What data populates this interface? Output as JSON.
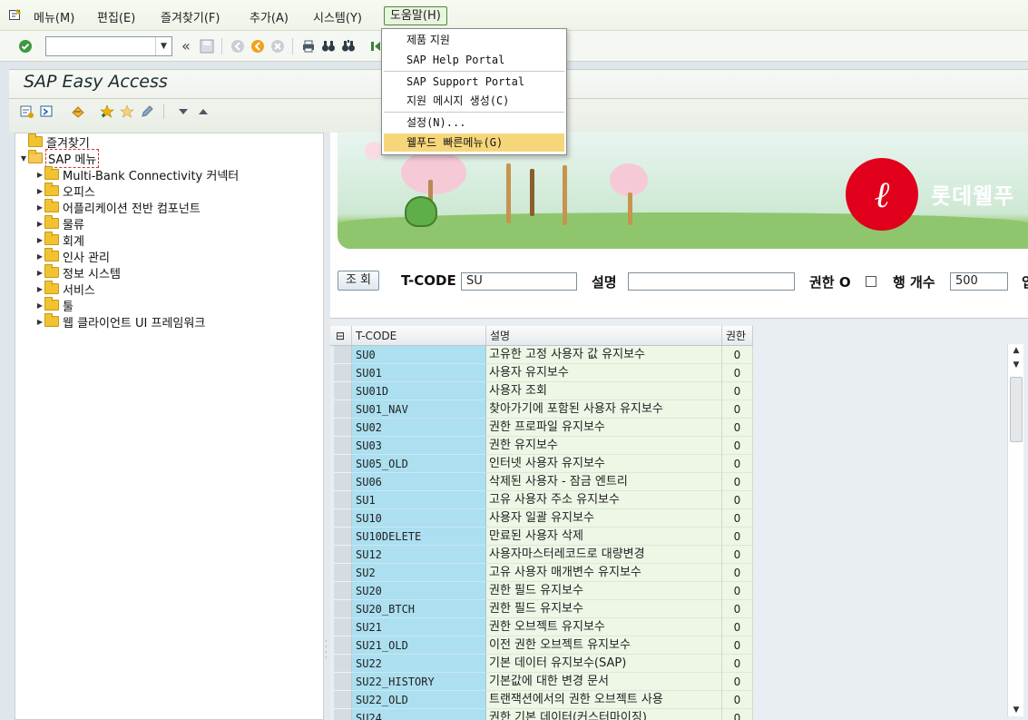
{
  "menubar": {
    "items": [
      "메뉴(M)",
      "편집(E)",
      "즐겨찾기(F)",
      "추가(A)",
      "시스템(Y)",
      "도움말(H)"
    ]
  },
  "help_menu": {
    "items": [
      "제품 지원",
      "SAP Help Portal",
      "SAP Support Portal",
      "지원 메시지 생성(C)",
      "설정(N)...",
      "웰푸드 빠른메뉴(G)"
    ],
    "highlighted_index": 5
  },
  "toolbar": {
    "command_value": "",
    "collapse_glyph": "«"
  },
  "page": {
    "title": "SAP Easy Access"
  },
  "tree": {
    "favorites": "즐겨찾기",
    "sap_menu": "SAP 메뉴",
    "children": [
      "Multi-Bank Connectivity 커넥터",
      "오피스",
      "어플리케이션 전반 컴포넌트",
      "물류",
      "회계",
      "인사 관리",
      "정보 시스템",
      "서비스",
      "툴",
      "웹 클라이언트 UI 프레임워크"
    ]
  },
  "banner": {
    "brand_text": "롯데웰푸"
  },
  "query": {
    "search_button": "조 회",
    "tcode_label": "T-CODE",
    "tcode_value": "SU",
    "desc_label": "설명",
    "desc_value": "",
    "auth_label": "권한 O",
    "rows_label": "행 개수",
    "rows_value": "500",
    "trailing_label": "입"
  },
  "grid": {
    "headers": [
      "T-CODE",
      "설명",
      "권한"
    ],
    "rows": [
      {
        "code": "SU0",
        "desc": "고유한 고정 사용자 값 유지보수",
        "auth": "0"
      },
      {
        "code": "SU01",
        "desc": "사용자 유지보수",
        "auth": "0"
      },
      {
        "code": "SU01D",
        "desc": "사용자 조회",
        "auth": "0"
      },
      {
        "code": "SU01_NAV",
        "desc": "찾아가기에 포함된 사용자 유지보수",
        "auth": "0"
      },
      {
        "code": "SU02",
        "desc": "권한 프로파일 유지보수",
        "auth": "0"
      },
      {
        "code": "SU03",
        "desc": "권한 유지보수",
        "auth": "0"
      },
      {
        "code": "SU05_OLD",
        "desc": "인터넷 사용자 유지보수",
        "auth": "0"
      },
      {
        "code": "SU06",
        "desc": "삭제된 사용자 - 잠금 엔트리",
        "auth": "0"
      },
      {
        "code": "SU1",
        "desc": "고유 사용자 주소 유지보수",
        "auth": "0"
      },
      {
        "code": "SU10",
        "desc": "사용자 일괄 유지보수",
        "auth": "0"
      },
      {
        "code": "SU10DELETE",
        "desc": "만료된 사용자 삭제",
        "auth": "0"
      },
      {
        "code": "SU12",
        "desc": "사용자마스터레코드로 대량변경",
        "auth": "0"
      },
      {
        "code": "SU2",
        "desc": "고유 사용자 매개변수 유지보수",
        "auth": "0"
      },
      {
        "code": "SU20",
        "desc": "권한 필드 유지보수",
        "auth": "0"
      },
      {
        "code": "SU20_BTCH",
        "desc": "권한 필드 유지보수",
        "auth": "0"
      },
      {
        "code": "SU21",
        "desc": "권한 오브젝트 유지보수",
        "auth": "0"
      },
      {
        "code": "SU21_OLD",
        "desc": "이전 권한 오브젝트 유지보수",
        "auth": "0"
      },
      {
        "code": "SU22",
        "desc": "기본 데이터 유지보수(SAP)",
        "auth": "0"
      },
      {
        "code": "SU22_HISTORY",
        "desc": "기본값에 대한 변경 문서",
        "auth": "0"
      },
      {
        "code": "SU22_OLD",
        "desc": "트랜잭션에서의 권한 오브젝트 사용",
        "auth": "0"
      },
      {
        "code": "SU24",
        "desc": "권한 기본 데이터(커스터마이징)",
        "auth": "0"
      }
    ]
  },
  "colors": {
    "tcode_cell": "#acdfef",
    "desc_cell": "#eef6e6",
    "menu_highlight": "#f6d67b",
    "brand_red": "#e0001b"
  }
}
